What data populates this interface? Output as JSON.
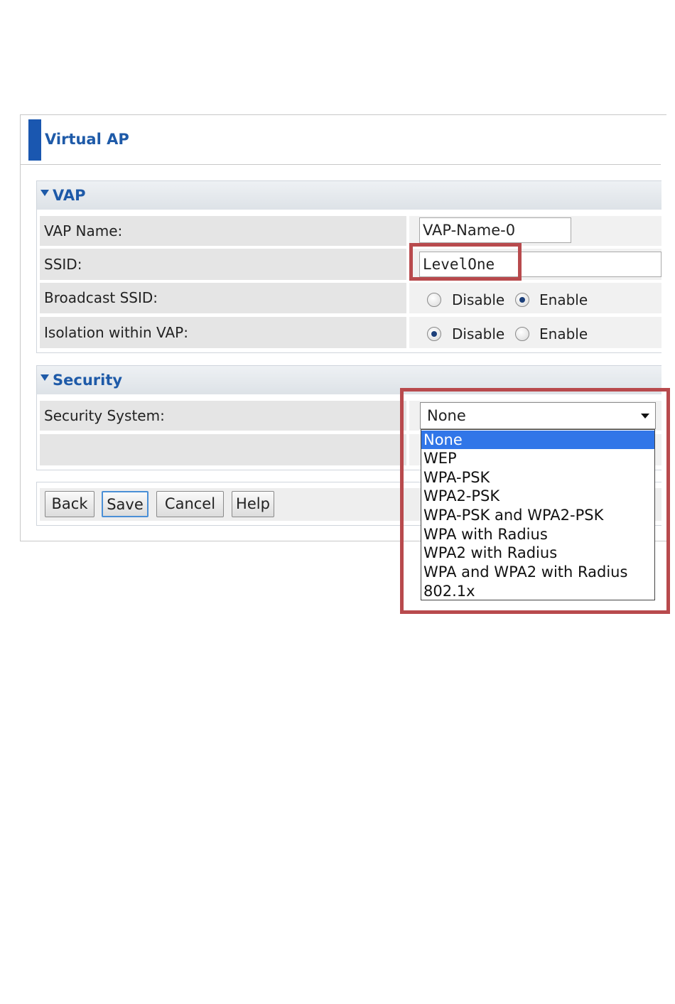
{
  "page": {
    "title": "Virtual AP"
  },
  "vap_section": {
    "heading": "VAP",
    "rows": {
      "vap_name": {
        "label": "VAP Name:",
        "value": "VAP-Name-0"
      },
      "ssid": {
        "label": "SSID:",
        "value": "LevelOne"
      },
      "broadcast_ssid": {
        "label": "Broadcast SSID:",
        "options": [
          "Disable",
          "Enable"
        ],
        "selected": "Enable"
      },
      "isolation": {
        "label": "Isolation within VAP:",
        "options": [
          "Disable",
          "Enable"
        ],
        "selected": "Disable"
      }
    }
  },
  "security_section": {
    "heading": "Security",
    "security_system": {
      "label": "Security System:",
      "selected": "None",
      "options": [
        "None",
        "WEP",
        "WPA-PSK",
        "WPA2-PSK",
        "WPA-PSK and WPA2-PSK",
        "WPA with Radius",
        "WPA2 with Radius",
        "WPA and WPA2 with Radius",
        "802.1x"
      ],
      "highlighted": "None"
    }
  },
  "buttons": {
    "back": "Back",
    "save": "Save",
    "cancel": "Cancel",
    "help": "Help"
  },
  "colors": {
    "accent": "#1a57b0",
    "highlight_box": "#b84a4d",
    "selected_option": "#3176e8"
  }
}
